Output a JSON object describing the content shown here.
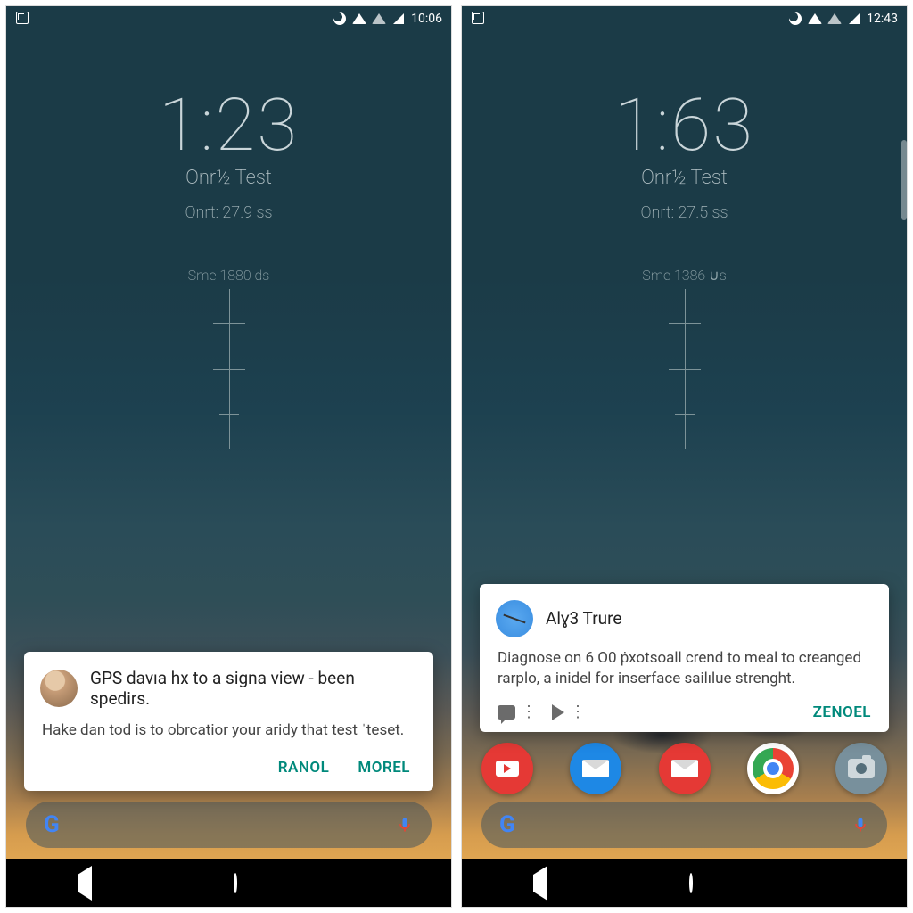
{
  "left": {
    "status": {
      "time": "10:06"
    },
    "clock": {
      "time": "1:23",
      "label": "Onr½ Test",
      "sub": "Onrt: 27.9 ss",
      "sec": "Sme 1880 ds"
    },
    "card": {
      "title": "GPS davıa hx to a signa view - been spedirs.",
      "body": "Hake dan tod is to obrcatior your aridy that test ˈteset.",
      "actions": {
        "left": "RANOL",
        "right": "MOREL"
      }
    }
  },
  "right": {
    "status": {
      "time": "12:43"
    },
    "clock": {
      "time": "1:63",
      "label": "Onr½ Test",
      "sub": "Onrt: 27.5 ss",
      "sec": "Sme 1386 ∪s"
    },
    "card": {
      "title": "Alɣ3 Trure",
      "body": "Diagnose on 6 O0 ṗxotsoall crend to meal to creanged rarplo, a inidel for inserface sailılue strenght.",
      "actions": {
        "right": "ZENOEL"
      }
    }
  },
  "search": {
    "logo": "G",
    "mic": "voice"
  }
}
